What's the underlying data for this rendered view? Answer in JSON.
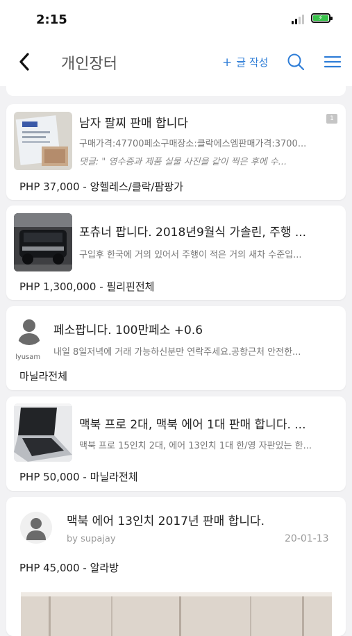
{
  "status_bar": {
    "time": "2:15"
  },
  "nav": {
    "title": "개인장터",
    "write_label": "글 작성",
    "icons": {
      "back": "chevron-left-icon",
      "search": "search-icon",
      "menu": "hamburger-menu-icon"
    },
    "accent_color": "#2e7dd7"
  },
  "listings": [
    {
      "title": "남자 팔찌 판매 합니다",
      "description": "구매가격:47700페소구매장소:클락에스엠판매가격:3700...",
      "comment": "댓글: \" 영수증과 제품 실물 사진을 같이 찍은 후에 수...",
      "price_location": "PHP 37,000 - 앙헬레스/클락/팜팡가",
      "badge": "1"
    },
    {
      "title": "포츄너 팝니다. 2018년9월식 가솔린,  주행 ...",
      "description": "구입후 한국에 거의 있어서 주행이 적은 거의 새차 수준입...",
      "price_location": "PHP 1,300,000 - 필리핀전체"
    },
    {
      "title": "페소팝니다. 100만페소 +0.6",
      "description": "내일 8일저녁에 거래 가능하신분만 연락주세요.공항근처 안전한...",
      "username": "lyusam",
      "location": "마닐라전체"
    },
    {
      "title": "맥북 프로 2대, 맥북 에어 1대 판매 합니다. ...",
      "description": "맥북 프로 15인치 2대, 에어 13인치 1대 한/영 자판있는 한...",
      "price_location": "PHP 50,000 - 마닐라전체"
    },
    {
      "title": "맥북 에어 13인치 2017년 판매 합니다.",
      "byline": "by supajay",
      "date": "20-01-13",
      "price_location": "PHP 45,000 - 알라방"
    }
  ]
}
